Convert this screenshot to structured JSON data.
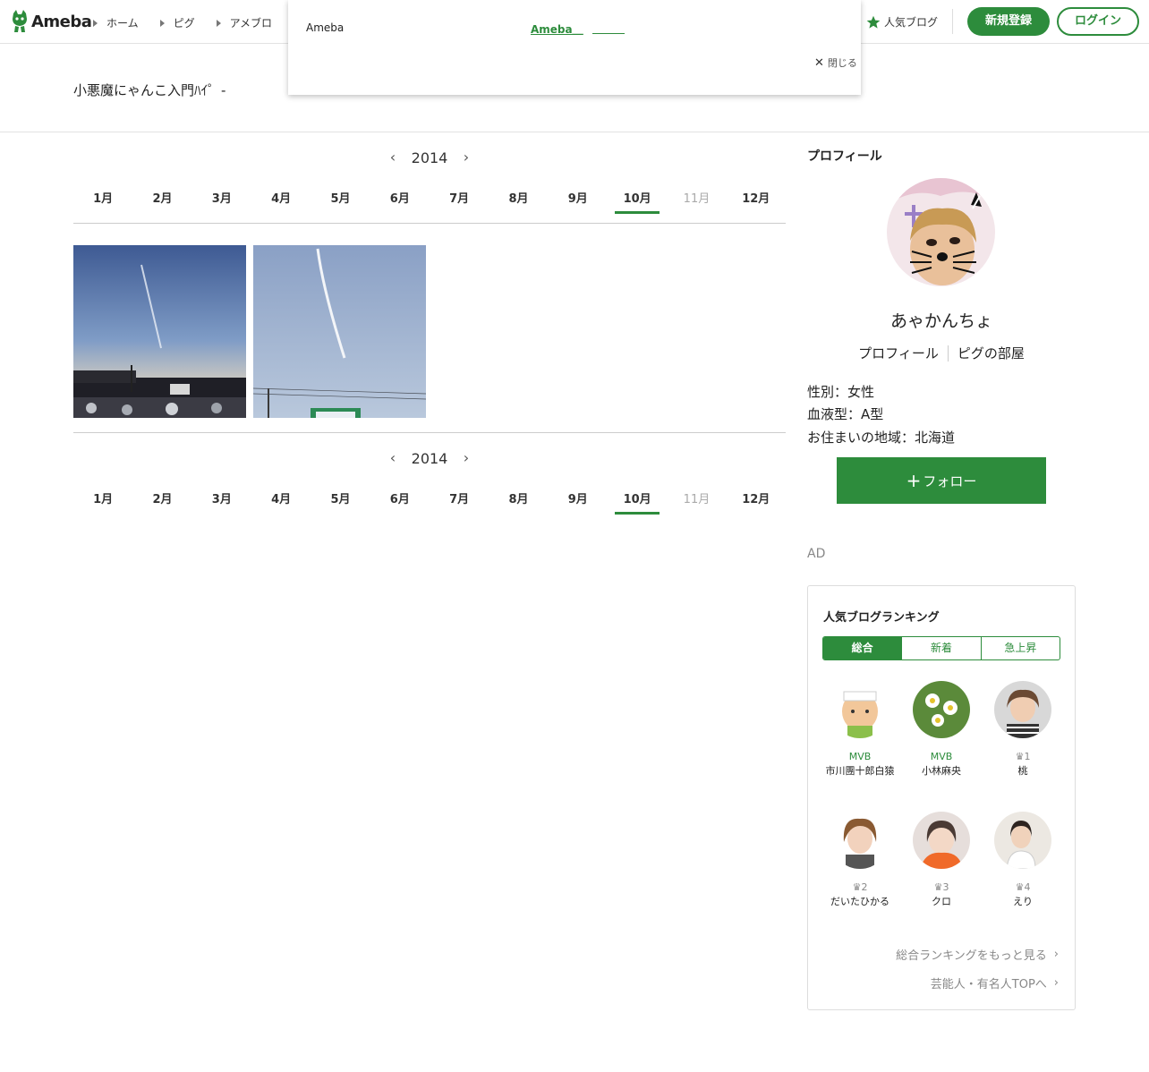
{
  "header": {
    "logo_text": "Ameba",
    "nav": [
      "ホーム",
      "ピグ",
      "アメブロ"
    ],
    "popular_label": "人気ブログ",
    "register_label": "新規登録",
    "login_label": "ログイン",
    "accent_color": "#2d8c3c"
  },
  "popup": {
    "brand": "Ameba",
    "link_text": "Ameba＿",
    "close_label": "閉じる"
  },
  "blog": {
    "title": "小悪魔にゃんこ入門ﾊｲ゜-"
  },
  "calendar": {
    "year": "2014",
    "months": [
      "1月",
      "2月",
      "3月",
      "4月",
      "5月",
      "6月",
      "7月",
      "8月",
      "9月",
      "10月",
      "11月",
      "12月"
    ],
    "active_month": "10月",
    "disabled_month": "11月"
  },
  "sidebar": {
    "profile_heading": "プロフィール",
    "name": "あゃかんちょ",
    "links": [
      "プロフィール",
      "ピグの部屋"
    ],
    "info": [
      "性別：女性",
      "血液型：A型",
      "お住まいの地域：北海道"
    ],
    "follow_label": "フォロー",
    "ad_label": "AD"
  },
  "ranking": {
    "title": "人気ブログランキング",
    "tabs": [
      "総合",
      "新着",
      "急上昇"
    ],
    "items": [
      {
        "badge": "MVB",
        "name": "市川團十郎白猿"
      },
      {
        "badge": "MVB",
        "name": "小林麻央"
      },
      {
        "badge": "1",
        "name": "桃"
      },
      {
        "badge": "2",
        "name": "だいたひかる"
      },
      {
        "badge": "3",
        "name": "クロ"
      },
      {
        "badge": "4",
        "name": "えり"
      }
    ],
    "more_label": "総合ランキングをもっと見る",
    "celeb_label": "芸能人・有名人TOPへ"
  }
}
